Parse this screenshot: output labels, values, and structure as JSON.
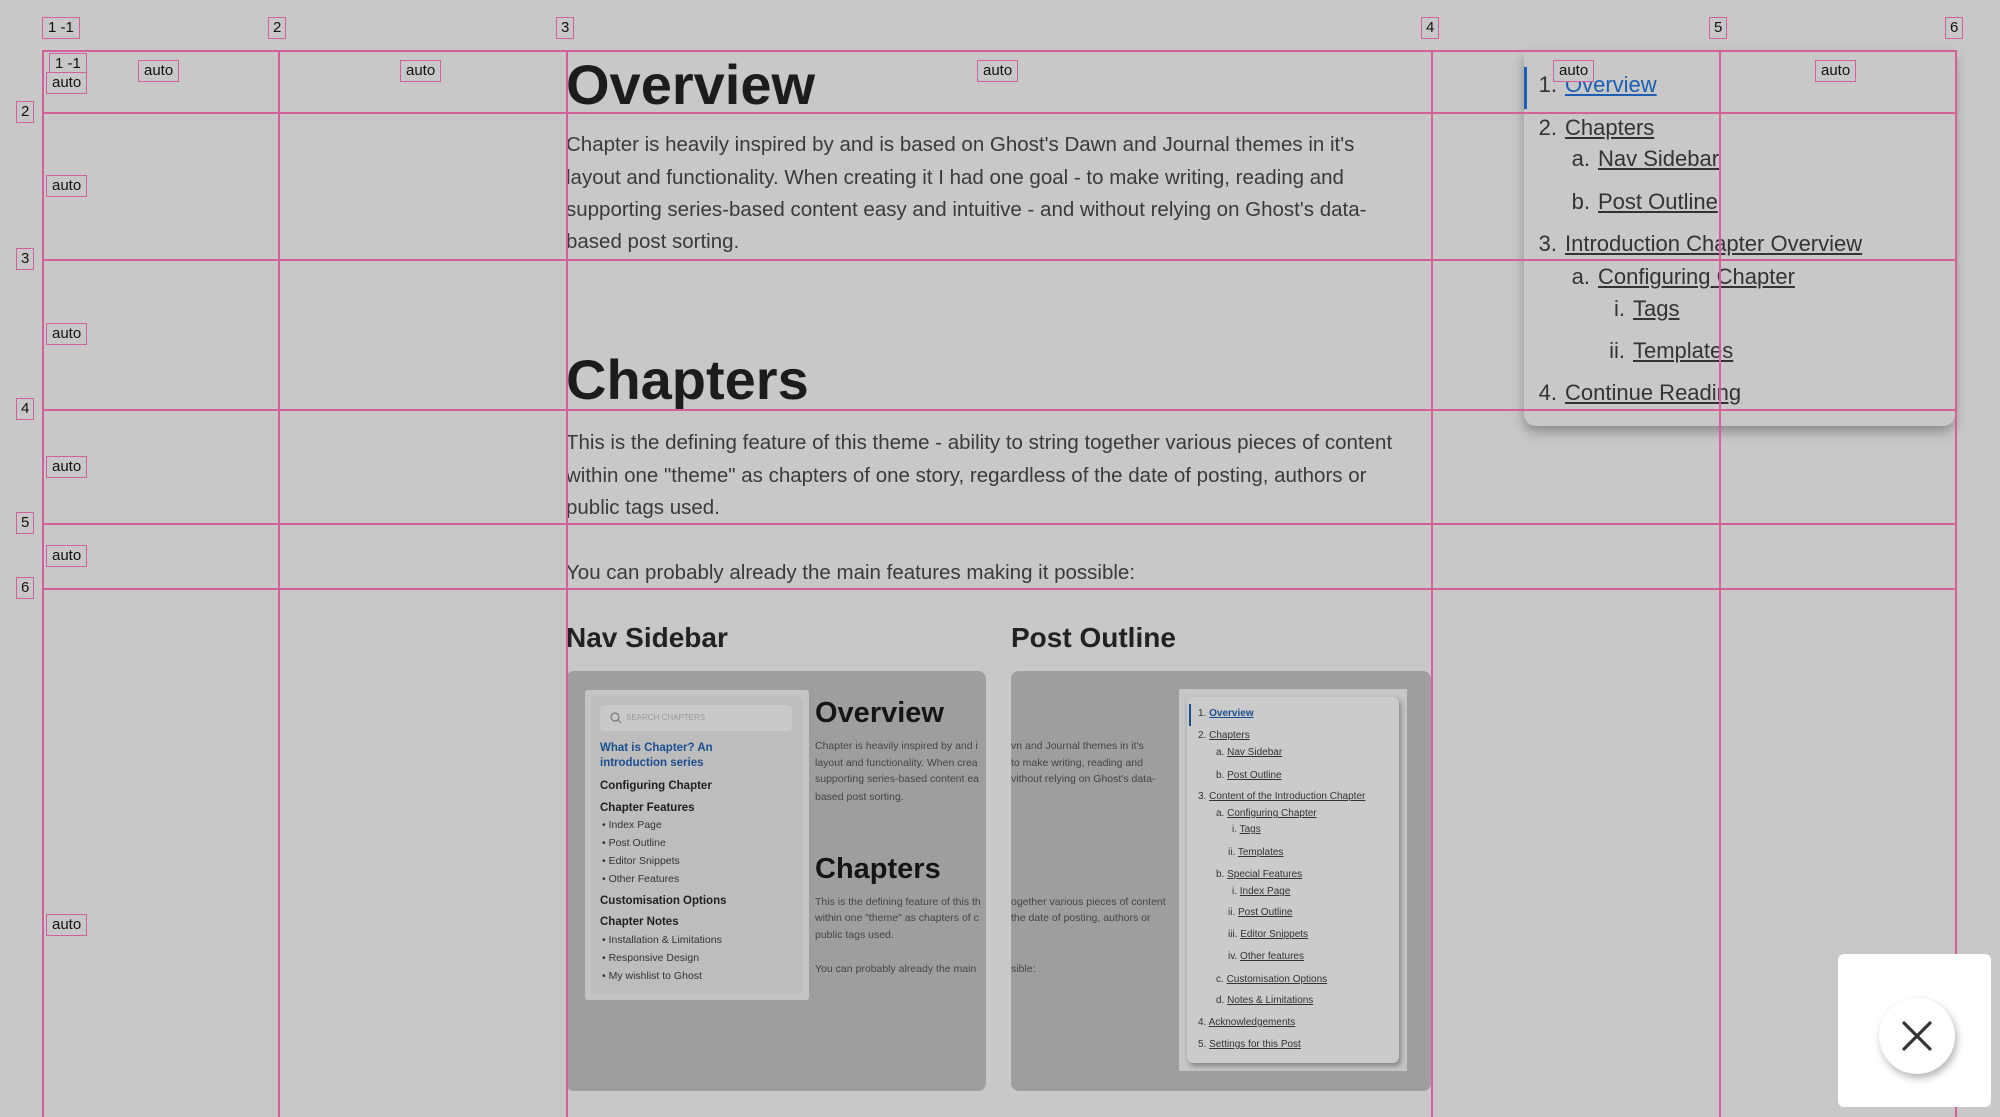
{
  "article": {
    "overview_heading": "Overview",
    "overview_lines": [
      "Chapter is heavily inspired by and is based on Ghost's Dawn and Journal themes in it's",
      "layout and functionality. When creating it I had one goal - to make writing, reading and",
      "supporting series-based content easy and intuitive - and without relying on Ghost's data-",
      "based post sorting."
    ],
    "chapters_heading": "Chapters",
    "chapters_lines": [
      "This is the defining feature of this theme - ability to string together various pieces of content",
      "within one \"theme\" as chapters of one story, regardless of the date of posting, authors or",
      "public tags used."
    ],
    "features_line": "You can probably already the main features making it possible:",
    "nav_sidebar_heading": "Nav Sidebar",
    "post_outline_heading": "Post Outline"
  },
  "nav_sidebar_image": {
    "search_placeholder": "SEARCH CHAPTERS",
    "active_title": [
      "What is Chapter? An",
      "introduction series"
    ],
    "configuring": "Configuring Chapter",
    "features": "Chapter Features",
    "feature_items": [
      "Index Page",
      "Post Outline",
      "Editor Snippets",
      "Other Features"
    ],
    "customisation": "Customisation Options",
    "notes": "Chapter Notes",
    "note_items": [
      "Installation & Limitations",
      "Responsive Design",
      "My wishlist to Ghost"
    ],
    "overview_heading": "Overview",
    "overview_lines": [
      "Chapter is heavily inspired by and i",
      "layout and functionality. When crea",
      "supporting series-based content ea",
      "based post sorting."
    ],
    "chapters_heading": "Chapters",
    "chapters_lines": [
      "This is the defining feature of this th",
      "within one \"theme\" as chapters of c",
      "public tags used."
    ],
    "features_line": "You can probably already the main"
  },
  "post_outline_image": {
    "text_lines": [
      "vn and Journal themes in it's",
      "to make writing, reading and",
      "vithout relying on Ghost's data-",
      "ogether various pieces of content",
      "the date of posting, authors or",
      "sible:"
    ],
    "items": [
      {
        "num": "1.",
        "label": "Overview",
        "level": 1,
        "active": true
      },
      {
        "num": "2.",
        "label": "Chapters",
        "level": 1
      },
      {
        "num": "a.",
        "label": "Nav Sidebar",
        "level": 2
      },
      {
        "num": "b.",
        "label": "Post Outline",
        "level": 2
      },
      {
        "num": "3.",
        "label": "Content of the Introduction Chapter",
        "level": 1
      },
      {
        "num": "a.",
        "label": "Configuring Chapter",
        "level": 2
      },
      {
        "num": "i.",
        "label": "Tags",
        "level": 3
      },
      {
        "num": "ii.",
        "label": "Templates",
        "level": 3
      },
      {
        "num": "b.",
        "label": "Special Features",
        "level": 2
      },
      {
        "num": "i.",
        "label": "Index Page",
        "level": 3
      },
      {
        "num": "ii.",
        "label": "Post Outline",
        "level": 3
      },
      {
        "num": "iii.",
        "label": "Editor Snippets",
        "level": 3
      },
      {
        "num": "iv.",
        "label": "Other features",
        "level": 3
      },
      {
        "num": "c.",
        "label": "Customisation Options",
        "level": 2
      },
      {
        "num": "d.",
        "label": "Notes & Limitations",
        "level": 2
      },
      {
        "num": "4.",
        "label": "Acknowledgements",
        "level": 1
      },
      {
        "num": "5.",
        "label": "Settings for this Post",
        "level": 1
      }
    ]
  },
  "outline": {
    "items": [
      {
        "num": "1.",
        "label": "Overview",
        "level": 1,
        "active": true
      },
      {
        "num": "2.",
        "label": "Chapters",
        "level": 1
      },
      {
        "num": "a.",
        "label": "Nav Sidebar",
        "level": 2
      },
      {
        "num": "b.",
        "label": "Post Outline",
        "level": 2
      },
      {
        "num": "3.",
        "label": "Introduction Chapter Overview",
        "level": 1
      },
      {
        "num": "a.",
        "label": "Configuring Chapter",
        "level": 2
      },
      {
        "num": "i.",
        "label": "Tags",
        "level": 3
      },
      {
        "num": "ii.",
        "label": "Templates",
        "level": 3
      },
      {
        "num": "4.",
        "label": "Continue Reading",
        "level": 1
      }
    ]
  },
  "grid_overlay": {
    "column_labels": [
      "1",
      "2",
      "3",
      "4",
      "5",
      "6"
    ],
    "row_labels": [
      "2",
      "3",
      "4",
      "5",
      "6"
    ],
    "corner_label": [
      "1",
      "-1"
    ],
    "track_label": "auto"
  },
  "close_button": {
    "icon": "close-icon"
  },
  "colors": {
    "accent": "#1a5fb4",
    "grid": "#d4609a",
    "background": "#c8c8c8"
  }
}
